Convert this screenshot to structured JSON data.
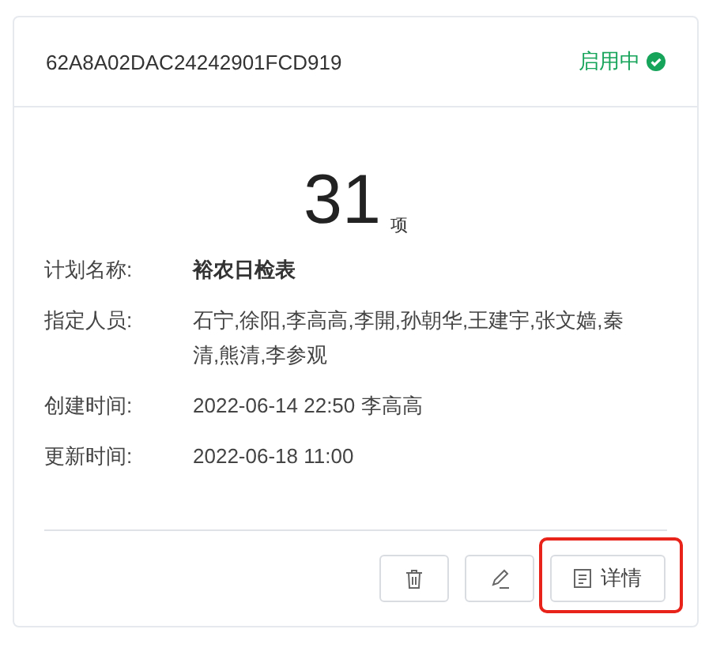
{
  "card": {
    "code": "62A8A02DAC24242901FCD919",
    "status": {
      "label": "启用中",
      "active": true
    },
    "count": "31",
    "count_unit": "项",
    "fields": [
      {
        "label": "计划名称:",
        "value": "裕农日检表",
        "bold": true
      },
      {
        "label": "指定人员:",
        "value": "石宁,徐阳,李高高,李開,孙朝华,王建宇,张文嫱,秦清,熊清,李参观",
        "bold": false
      },
      {
        "label": "创建时间:",
        "value": "2022-06-14 22:50 李高高",
        "bold": false
      },
      {
        "label": "更新时间:",
        "value": "2022-06-18 11:00",
        "bold": false
      }
    ],
    "actions": [
      {
        "kind": "delete",
        "highlighted": false
      },
      {
        "kind": "edit",
        "highlighted": false
      },
      {
        "kind": "detail",
        "label": "详情",
        "highlighted": true
      }
    ]
  }
}
